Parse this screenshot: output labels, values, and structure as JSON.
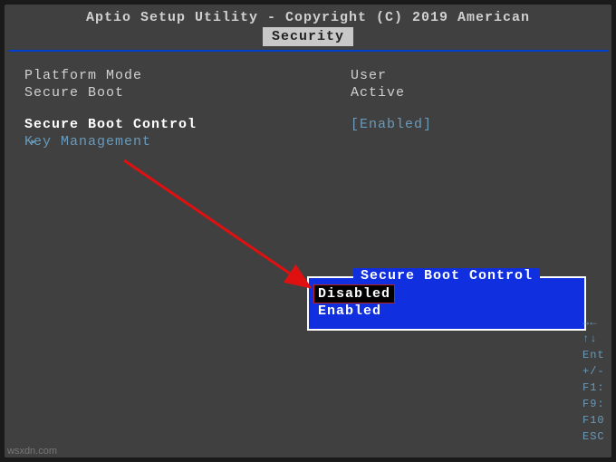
{
  "header": {
    "title": "Aptio Setup Utility - Copyright (C) 2019 American"
  },
  "tabs": {
    "active": "Security"
  },
  "info": {
    "platform_mode_label": "Platform Mode",
    "platform_mode_value": "User",
    "secure_boot_label": "Secure Boot",
    "secure_boot_value": "Active"
  },
  "menu": {
    "secure_boot_control_label": "Secure Boot Control",
    "secure_boot_control_value": "[Enabled]",
    "key_management_label": "Key Management"
  },
  "popup": {
    "title": "Secure Boot Control",
    "options": {
      "disabled": "Disabled",
      "enabled": "Enabled"
    }
  },
  "help_keys": {
    "k0": "→←",
    "k1": "↑↓",
    "k2": "Ent",
    "k3": "+/-",
    "k4": "F1:",
    "k5": "F9:",
    "k6": "F10",
    "k7": "ESC"
  },
  "watermark": "wsxdn.com"
}
